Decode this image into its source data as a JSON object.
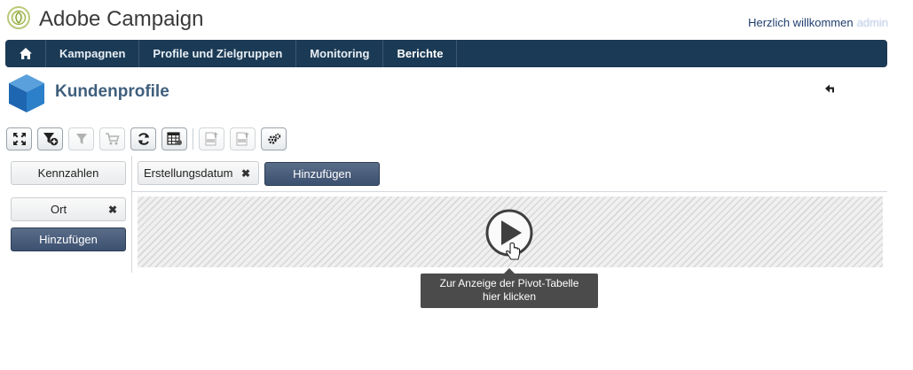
{
  "header": {
    "app_title": "Adobe Campaign",
    "welcome_text": "Herzlich willkommen",
    "user_name": "admin"
  },
  "nav": {
    "home_icon": "home-icon",
    "items": [
      {
        "label": "Kampagnen",
        "active": false
      },
      {
        "label": "Profile und Zielgruppen",
        "active": false
      },
      {
        "label": "Monitoring",
        "active": false
      },
      {
        "label": "Berichte",
        "active": true
      }
    ]
  },
  "page": {
    "title": "Kundenprofile",
    "title_icon": "cube-icon",
    "back_icon": "back-arrow-icon"
  },
  "toolbar": {
    "buttons": [
      {
        "icon": "expand-icon",
        "enabled": true
      },
      {
        "icon": "add-filter-icon",
        "enabled": true
      },
      {
        "icon": "filter-icon",
        "enabled": false
      },
      {
        "icon": "cart-icon",
        "enabled": false
      },
      {
        "icon": "refresh-icon",
        "enabled": true
      },
      {
        "icon": "table-settings-icon",
        "enabled": true
      },
      {
        "icon": "export-pdf-icon",
        "enabled": false
      },
      {
        "icon": "export-xls-icon",
        "enabled": false
      },
      {
        "icon": "settings-icon",
        "enabled": true
      }
    ]
  },
  "pivot": {
    "measures_label": "Kennzahlen",
    "column_chip": "Erstellungsdatum",
    "column_add_label": "Hinzufügen",
    "row_chip": "Ort",
    "row_add_label": "Hinzufügen",
    "remove_icon": "close-icon",
    "play_icon": "play-icon",
    "tooltip_line1": "Zur Anzeige der Pivot-Tabelle",
    "tooltip_line2": "hier klicken"
  },
  "colors": {
    "nav_bg": "#1b3a55",
    "primary_button": "#4a5d7b",
    "title": "#3f5f7d",
    "tooltip_bg": "#4b4b4b"
  }
}
